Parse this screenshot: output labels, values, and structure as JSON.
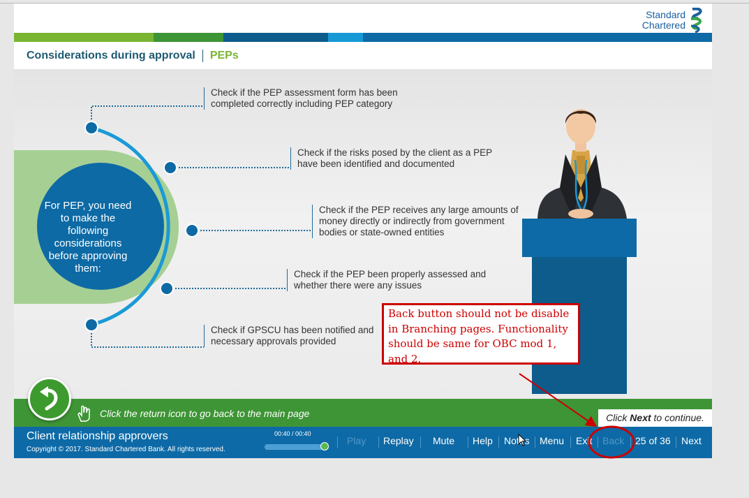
{
  "brand": {
    "logo_line1": "Standard",
    "logo_line2": "Chartered"
  },
  "colors": {
    "green": "#7ab532",
    "dark_green": "#3e9536",
    "blue": "#0e6aa6",
    "dark_blue": "#0d5c8c",
    "light_blue": "#1799d6",
    "annotation_red": "#cc0000"
  },
  "header": {
    "title": "Considerations during approval",
    "subtitle": "PEPs"
  },
  "center": {
    "text": "For PEP, you need to make the following considerations before approving them:"
  },
  "items": [
    "Check if the PEP assessment form has been completed correctly including PEP category",
    "Check if the risks posed by the client as a PEP have been identified and documented",
    "Check if the PEP receives any large amounts of money directly or indirectly from government bodies or state-owned entities",
    "Check if the PEP been properly assessed and whether there were any issues",
    "Check if GPSCU has been notified and necessary approvals provided"
  ],
  "return_bar": {
    "text": "Click the return icon to go back to the main page",
    "icon": "return-arrow-icon"
  },
  "next_hint": {
    "prefix": "Click ",
    "bold": "Next",
    "suffix": " to continue."
  },
  "footer": {
    "course_title": "Client relationship approvers",
    "copyright": "Copyright © 2017. Standard Chartered Bank. All rights reserved.",
    "timer": "00:40 / 00:40",
    "progress": 1.0,
    "nav": {
      "play": "Play",
      "replay": "Replay",
      "mute": "Mute",
      "help": "Help",
      "notes": "Notes",
      "menu": "Menu",
      "exit": "Exit",
      "back": "Back",
      "page": "25 of 36",
      "next": "Next"
    }
  },
  "annotation": {
    "text": "Back button should not be disable in Branching pages. Functionality should be same for OBC mod 1, and 2."
  }
}
